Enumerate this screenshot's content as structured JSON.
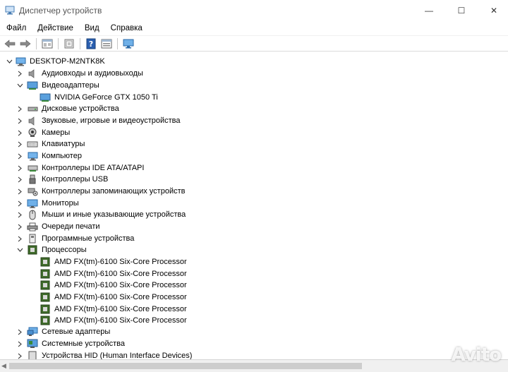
{
  "window": {
    "title": "Диспетчер устройств",
    "minimize_glyph": "—",
    "maximize_glyph": "☐",
    "close_glyph": "✕"
  },
  "menu": [
    "Файл",
    "Действие",
    "Вид",
    "Справка"
  ],
  "toolbar": [
    "back-arrow-icon",
    "forward-arrow-icon",
    "device-properties-icon",
    "update-driver-icon",
    "help-icon",
    "view-resources-icon",
    "scan-hardware-icon"
  ],
  "tree": {
    "root": "DESKTOP-M2NTK8K",
    "categories": {
      "audio_io": "Аудиовходы и аудиовыходы",
      "video": "Видеоадаптеры",
      "gpu": "NVIDIA GeForce GTX 1050 Ti",
      "disks": "Дисковые устройства",
      "sound": "Звуковые, игровые и видеоустройства",
      "cameras": "Камеры",
      "keyboards": "Клавиатуры",
      "computer": "Компьютер",
      "ide": "Контроллеры IDE ATA/ATAPI",
      "usb": "Контроллеры USB",
      "storage": "Контроллеры запоминающих устройств",
      "monitors": "Мониторы",
      "mice": "Мыши и иные указывающие устройства",
      "print_queues": "Очереди печати",
      "software": "Программные устройства",
      "processors": "Процессоры",
      "network": "Сетевые адаптеры",
      "system": "Системные устройства",
      "hid": "Устройства HID (Human Interface Devices)"
    },
    "cpus": [
      "AMD FX(tm)-6100 Six-Core Processor",
      "AMD FX(tm)-6100 Six-Core Processor",
      "AMD FX(tm)-6100 Six-Core Processor",
      "AMD FX(tm)-6100 Six-Core Processor",
      "AMD FX(tm)-6100 Six-Core Processor",
      "AMD FX(tm)-6100 Six-Core Processor"
    ]
  },
  "watermark": "Avito",
  "colors": {
    "accent": "#2a72c6",
    "cpu_green": "#3f6b2a"
  }
}
